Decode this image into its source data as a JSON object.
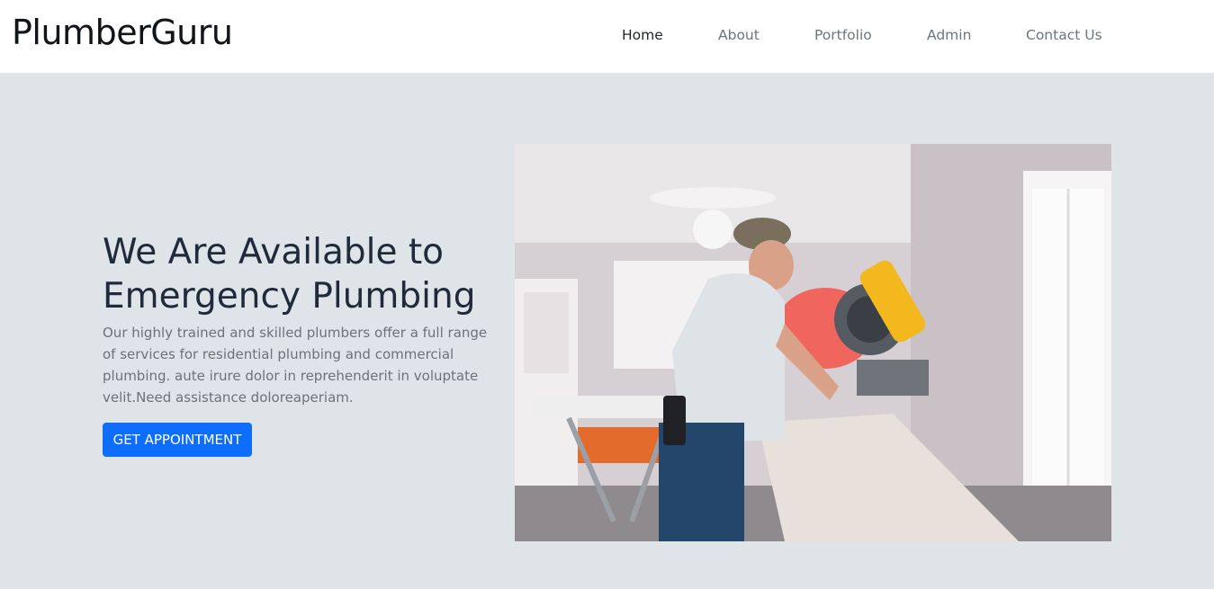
{
  "brand": "PlumberGuru",
  "nav": {
    "items": [
      {
        "label": "Home",
        "active": true
      },
      {
        "label": "About",
        "active": false
      },
      {
        "label": "Portfolio",
        "active": false
      },
      {
        "label": "Admin",
        "active": false
      },
      {
        "label": "Contact Us",
        "active": false
      }
    ]
  },
  "hero": {
    "headline_line1": "We Are Available to",
    "headline_line2": "Emergency Plumbing",
    "description": "Our highly trained and skilled plumbers offer a full range of services for residential plumbing and commercial plumbing. aute irure dolor in reprehenderit in voluptate velit.Need assistance doloreaperiam.",
    "cta_label": "GET APPOINTMENT",
    "image_name": "workers-miter-saw-photo"
  },
  "colors": {
    "accent": "#0d6efd",
    "hero_bg": "#dee4e8",
    "heading": "#1f2a3b",
    "muted_text": "#6b727a"
  }
}
